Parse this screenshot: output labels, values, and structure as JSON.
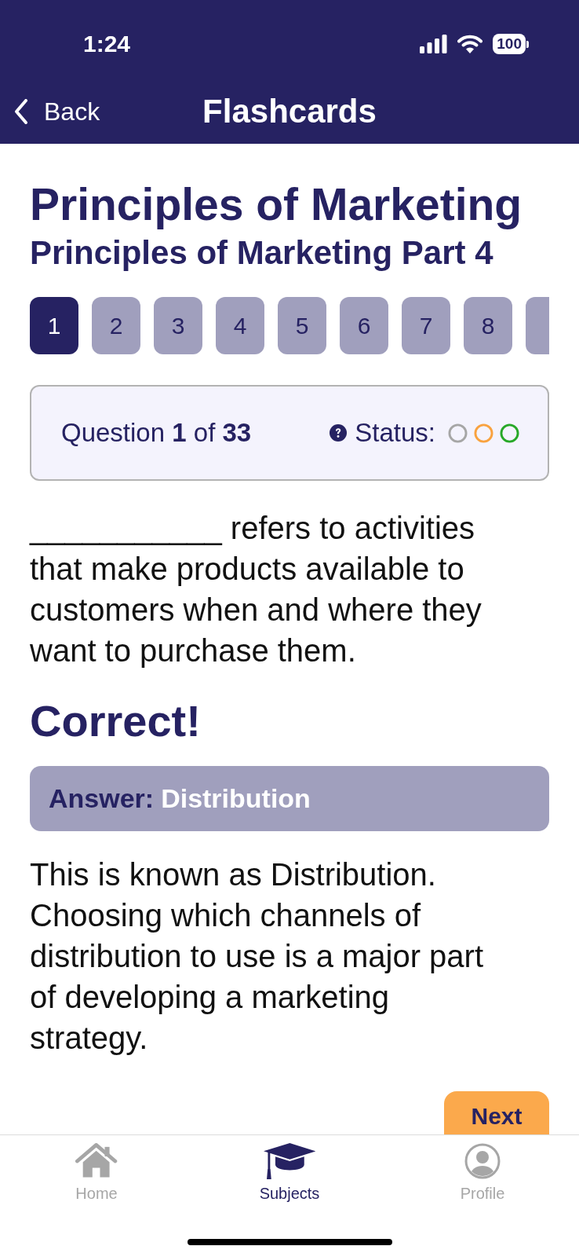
{
  "status_bar": {
    "time": "1:24",
    "battery": "100"
  },
  "nav_bar": {
    "back_label": "Back",
    "title": "Flashcards"
  },
  "course": {
    "title": "Principles of Marketing",
    "subtitle": "Principles of Marketing Part 4"
  },
  "question_tabs": [
    {
      "label": "1",
      "selected": true
    },
    {
      "label": "2",
      "selected": false
    },
    {
      "label": "3",
      "selected": false
    },
    {
      "label": "4",
      "selected": false
    },
    {
      "label": "5",
      "selected": false
    },
    {
      "label": "6",
      "selected": false
    },
    {
      "label": "7",
      "selected": false
    },
    {
      "label": "8",
      "selected": false
    },
    {
      "selected": false
    }
  ],
  "question_info": {
    "text": "Question **1** of **33**",
    "status_label": "Status:",
    "status_marks": [
      {
        "color": "#a6a6a6"
      },
      {
        "color": "#f9a23f"
      },
      {
        "color": "#28a828"
      }
    ]
  },
  "question": "___________ refers to activities that make products available to customers when and where they want to purchase them.",
  "result": "Correct!",
  "answer": {
    "label": "Answer:",
    "value": "Distribution"
  },
  "explanation": "This is known as Distribution. Choosing which channels of distribution to use is a major part of developing a marketing strategy.",
  "next_button": "Next",
  "tab_bar": [
    {
      "kind": "home",
      "label": "Home",
      "selected": false
    },
    {
      "kind": "subjects",
      "label": "Subjects",
      "selected": true
    },
    {
      "kind": "profile",
      "label": "Profile",
      "selected": false
    }
  ]
}
